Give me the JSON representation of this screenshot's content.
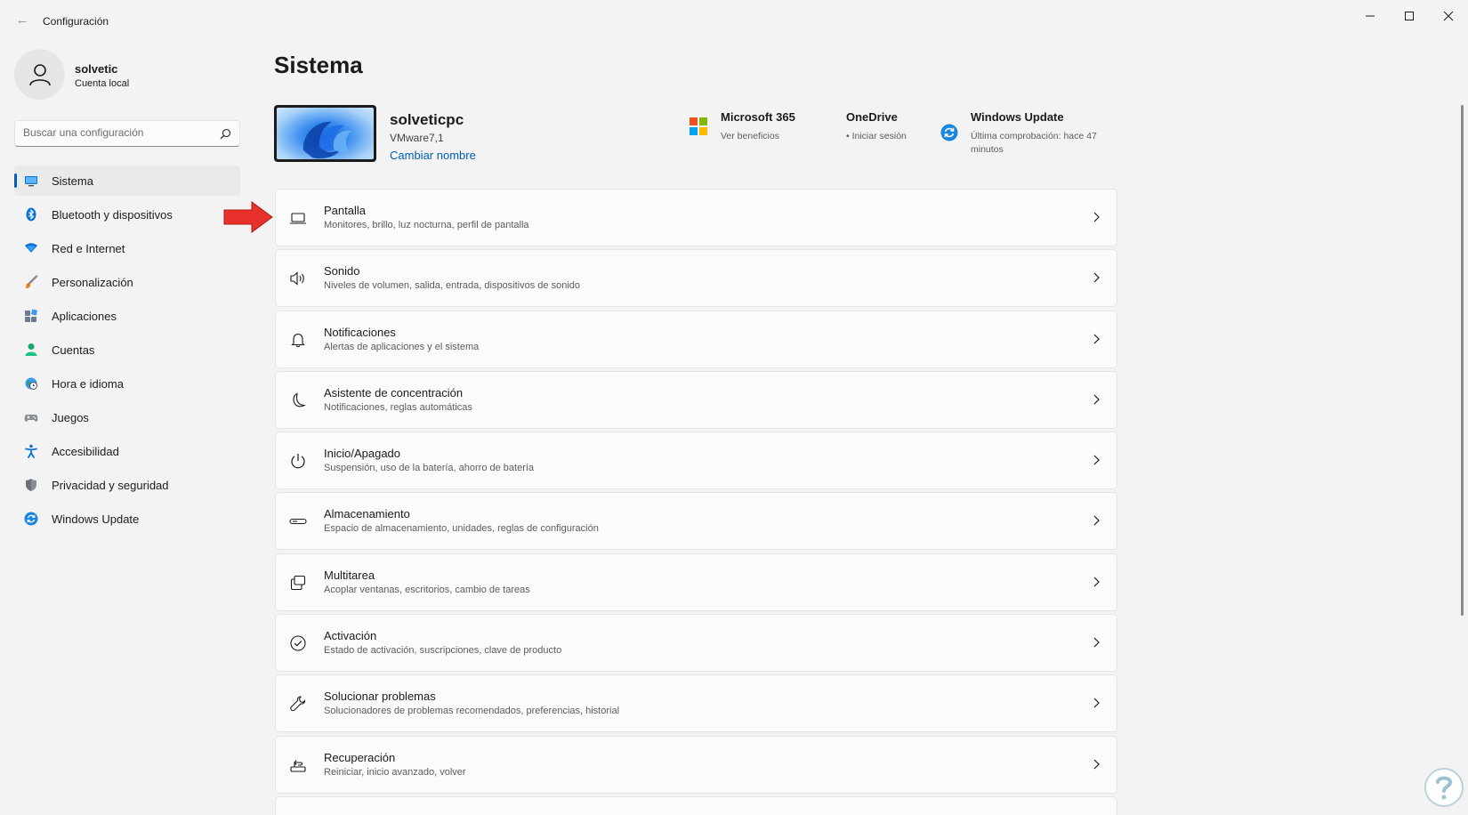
{
  "window": {
    "title": "Configuración"
  },
  "profile": {
    "name": "solvetic",
    "account_type": "Cuenta local"
  },
  "search": {
    "placeholder": "Buscar una configuración"
  },
  "sidebar": {
    "items": [
      {
        "label": "Sistema",
        "icon": "monitor-icon",
        "active": true
      },
      {
        "label": "Bluetooth y dispositivos",
        "icon": "bluetooth-icon"
      },
      {
        "label": "Red e Internet",
        "icon": "wifi-icon"
      },
      {
        "label": "Personalización",
        "icon": "brush-icon"
      },
      {
        "label": "Aplicaciones",
        "icon": "apps-icon"
      },
      {
        "label": "Cuentas",
        "icon": "person-icon"
      },
      {
        "label": "Hora e idioma",
        "icon": "globe-clock-icon"
      },
      {
        "label": "Juegos",
        "icon": "gamepad-icon"
      },
      {
        "label": "Accesibilidad",
        "icon": "accessibility-icon"
      },
      {
        "label": "Privacidad y seguridad",
        "icon": "shield-icon"
      },
      {
        "label": "Windows Update",
        "icon": "update-icon"
      }
    ]
  },
  "main": {
    "title": "Sistema",
    "device": {
      "name": "solveticpc",
      "model": "VMware7,1",
      "rename_label": "Cambiar nombre"
    },
    "status": {
      "ms365": {
        "title": "Microsoft 365",
        "sub": "Ver beneficios"
      },
      "onedrive": {
        "title": "OneDrive",
        "sub": "• Iniciar sesión"
      },
      "update": {
        "title": "Windows Update",
        "sub": "Última comprobación: hace 47 minutos"
      }
    },
    "cards": [
      {
        "title": "Pantalla",
        "sub": "Monitores, brillo, luz nocturna, perfil de pantalla",
        "icon": "display-icon"
      },
      {
        "title": "Sonido",
        "sub": "Niveles de volumen, salida, entrada, dispositivos de sonido",
        "icon": "speaker-icon"
      },
      {
        "title": "Notificaciones",
        "sub": "Alertas de aplicaciones y el sistema",
        "icon": "bell-icon"
      },
      {
        "title": "Asistente de concentración",
        "sub": "Notificaciones, reglas automáticas",
        "icon": "moon-icon"
      },
      {
        "title": "Inicio/Apagado",
        "sub": "Suspensión, uso de la batería, ahorro de batería",
        "icon": "power-icon"
      },
      {
        "title": "Almacenamiento",
        "sub": "Espacio de almacenamiento, unidades, reglas de configuración",
        "icon": "storage-icon"
      },
      {
        "title": "Multitarea",
        "sub": "Acoplar ventanas, escritorios, cambio de tareas",
        "icon": "multitask-icon"
      },
      {
        "title": "Activación",
        "sub": "Estado de activación, suscripciones, clave de producto",
        "icon": "check-circle-icon"
      },
      {
        "title": "Solucionar problemas",
        "sub": "Solucionadores de problemas recomendados, preferencias, historial",
        "icon": "wrench-icon"
      },
      {
        "title": "Recuperación",
        "sub": "Reiniciar, inicio avanzado, volver",
        "icon": "recovery-icon"
      }
    ]
  },
  "colors": {
    "accent": "#005fb8",
    "arrow": "#e8312b",
    "background": "#f3f3f3",
    "card": "#fbfbfb"
  }
}
